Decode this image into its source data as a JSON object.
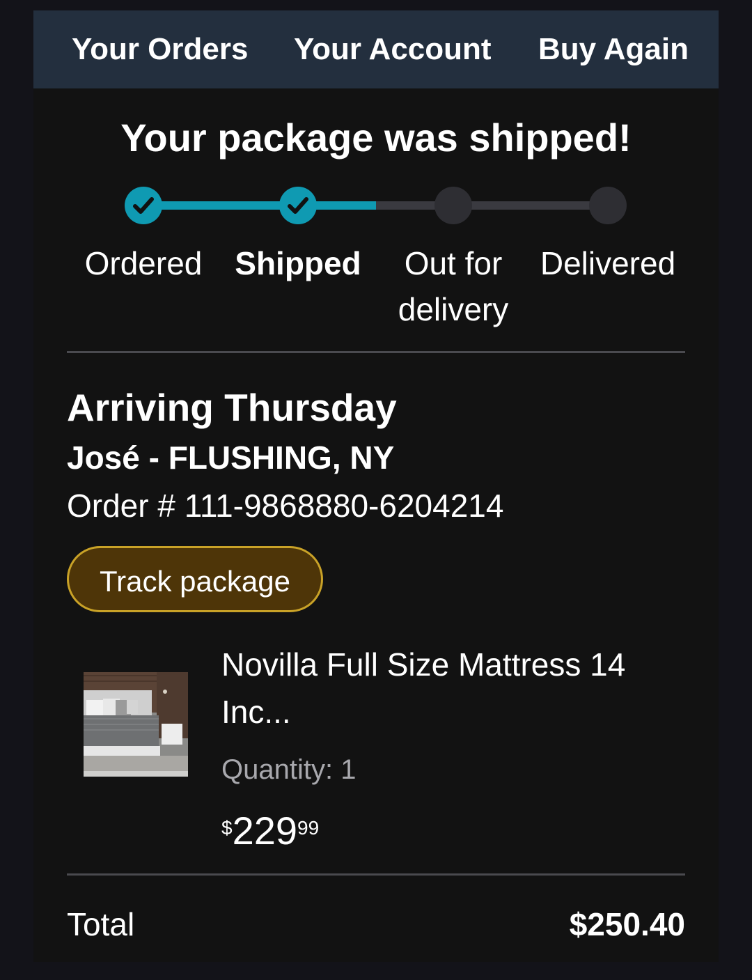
{
  "nav": {
    "items": [
      {
        "label": "Your Orders"
      },
      {
        "label": "Your Account"
      },
      {
        "label": "Buy Again"
      }
    ]
  },
  "status": {
    "headline": "Your package was shipped!"
  },
  "progress": {
    "steps": [
      {
        "line1": "Ordered",
        "line2": "",
        "state": "done"
      },
      {
        "line1": "Shipped",
        "line2": "",
        "state": "current"
      },
      {
        "line1": "Out for",
        "line2": "delivery",
        "state": "pending"
      },
      {
        "line1": "Delivered",
        "line2": "",
        "state": "pending"
      }
    ],
    "colors": {
      "done": "#0f9ab2",
      "pending": "#2e2e33"
    }
  },
  "delivery": {
    "arriving": "Arriving Thursday",
    "recipient": "José - FLUSHING, NY",
    "order_number": "Order # 111-9868880-6204214",
    "track_button": "Track package"
  },
  "item": {
    "title": "Novilla Full Size Mattress 14 Inc...",
    "quantity": "Quantity: 1",
    "price_currency": "$",
    "price_whole": "229",
    "price_fraction": "99",
    "image_icon": "mattress-photo"
  },
  "summary": {
    "total_label": "Total",
    "total_value": "$250.40"
  },
  "theme": {
    "nav_bg": "#232f3e",
    "button_bg": "#4e3508",
    "button_border": "#c9a227",
    "accent": "#0f9ab2"
  }
}
